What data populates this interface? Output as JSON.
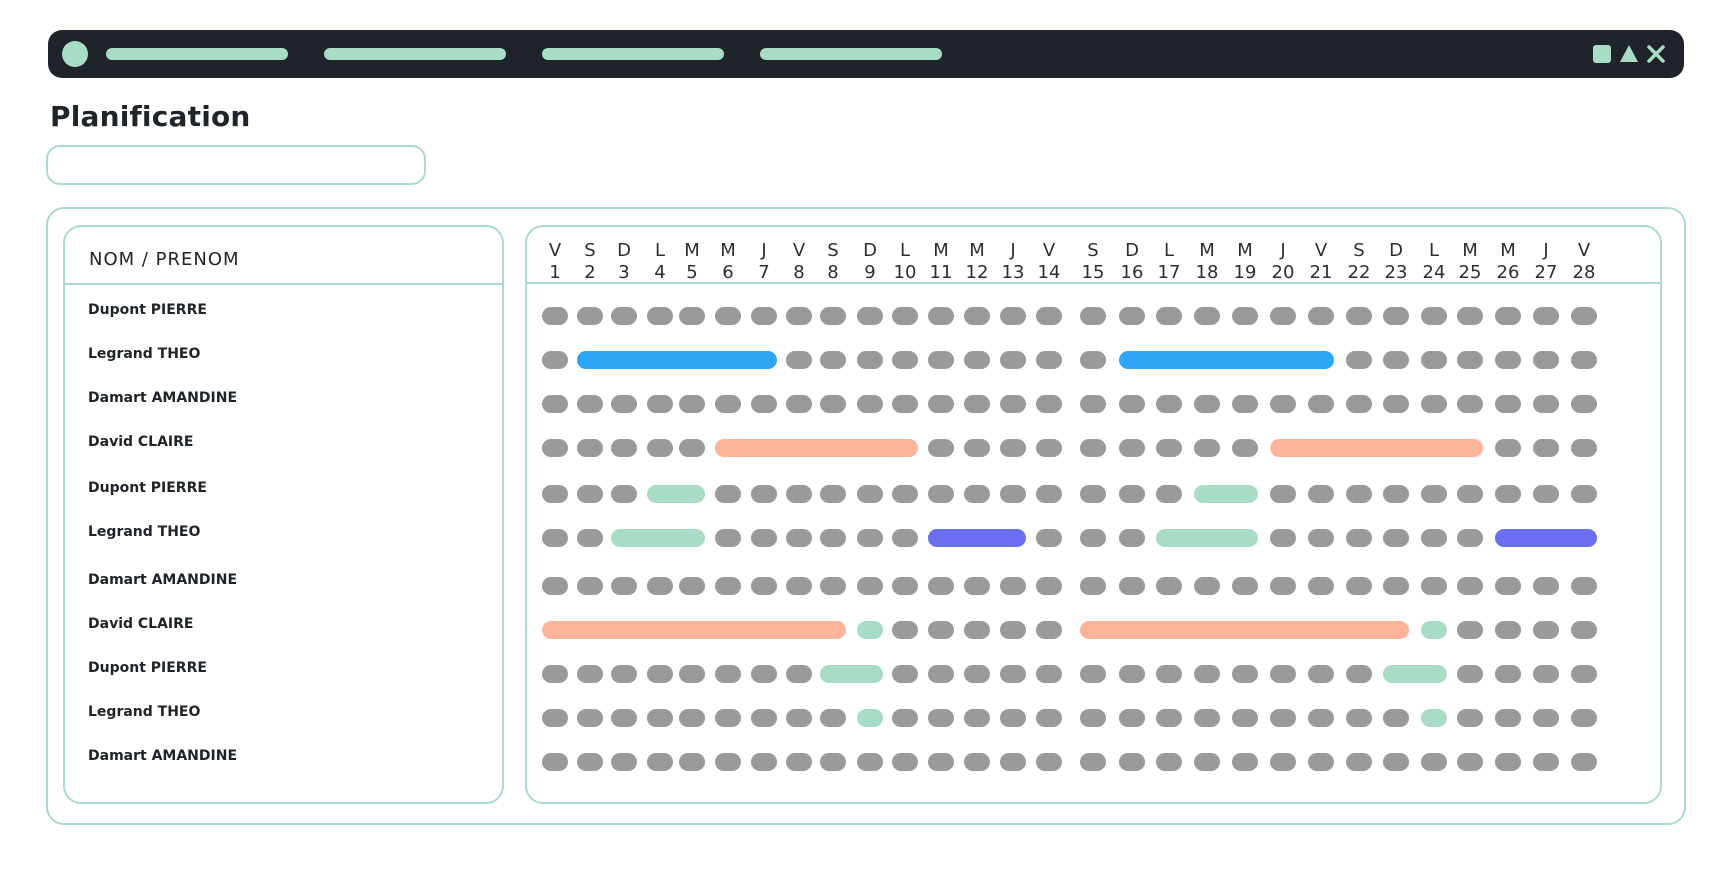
{
  "window": {
    "accent": "#a9dcc4",
    "chrome": "#1f232a",
    "nav_items": 4,
    "controls": [
      "square-icon",
      "triangle-icon",
      "close-icon"
    ]
  },
  "page": {
    "title": "Planification",
    "search": {
      "value": "",
      "placeholder": ""
    }
  },
  "table": {
    "name_header": "NOM / PRENOM",
    "days": [
      {
        "letter": "V",
        "num": "1"
      },
      {
        "letter": "S",
        "num": "2"
      },
      {
        "letter": "D",
        "num": "3"
      },
      {
        "letter": "L",
        "num": "4"
      },
      {
        "letter": "M",
        "num": "5"
      },
      {
        "letter": "M",
        "num": "6"
      },
      {
        "letter": "J",
        "num": "7"
      },
      {
        "letter": "V",
        "num": "8"
      },
      {
        "letter": "S",
        "num": "8"
      },
      {
        "letter": "D",
        "num": "9"
      },
      {
        "letter": "L",
        "num": "10"
      },
      {
        "letter": "M",
        "num": "11"
      },
      {
        "letter": "M",
        "num": "12"
      },
      {
        "letter": "J",
        "num": "13"
      },
      {
        "letter": "V",
        "num": "14"
      },
      {
        "letter": "S",
        "num": "15"
      },
      {
        "letter": "D",
        "num": "16"
      },
      {
        "letter": "L",
        "num": "17"
      },
      {
        "letter": "M",
        "num": "18"
      },
      {
        "letter": "M",
        "num": "19"
      },
      {
        "letter": "J",
        "num": "20"
      },
      {
        "letter": "V",
        "num": "21"
      },
      {
        "letter": "S",
        "num": "22"
      },
      {
        "letter": "D",
        "num": "23"
      },
      {
        "letter": "L",
        "num": "24"
      },
      {
        "letter": "M",
        "num": "25"
      },
      {
        "letter": "M",
        "num": "26"
      },
      {
        "letter": "J",
        "num": "27"
      },
      {
        "letter": "V",
        "num": "28"
      }
    ],
    "colors": {
      "empty": "#9a9a9a",
      "blue": "#2fa6f5",
      "salmon": "#fdb49b",
      "mint": "#a9dcc4",
      "indigo": "#6a6ef0"
    },
    "rows": [
      {
        "name": "Dupont PIERRE",
        "bars": []
      },
      {
        "name": "Legrand THEO",
        "bars": [
          {
            "from": 2,
            "to": 7,
            "color": "blue"
          },
          {
            "from": 17,
            "to": 22,
            "color": "blue"
          }
        ]
      },
      {
        "name": "Damart AMANDINE",
        "bars": []
      },
      {
        "name": "David CLAIRE",
        "bars": [
          {
            "from": 6,
            "to": 11,
            "color": "salmon"
          },
          {
            "from": 21,
            "to": 26,
            "color": "salmon"
          }
        ]
      },
      {
        "name": "Dupont PIERRE",
        "bars": [
          {
            "from": 4,
            "to": 5,
            "color": "mint"
          },
          {
            "from": 19,
            "to": 20,
            "color": "mint"
          }
        ]
      },
      {
        "name": "Legrand THEO",
        "bars": [
          {
            "from": 3,
            "to": 5,
            "color": "mint"
          },
          {
            "from": 12,
            "to": 14,
            "color": "indigo"
          },
          {
            "from": 18,
            "to": 20,
            "color": "mint"
          },
          {
            "from": 27,
            "to": 29,
            "color": "indigo"
          }
        ]
      },
      {
        "name": "Damart AMANDINE",
        "bars": []
      },
      {
        "name": "David CLAIRE",
        "bars": [
          {
            "from": 1,
            "to": 9,
            "color": "salmon"
          },
          {
            "from": 10,
            "to": 10,
            "color": "mint"
          },
          {
            "from": 16,
            "to": 24,
            "color": "salmon"
          },
          {
            "from": 25,
            "to": 25,
            "color": "mint"
          }
        ]
      },
      {
        "name": "Dupont PIERRE",
        "bars": [
          {
            "from": 9,
            "to": 10,
            "color": "mint"
          },
          {
            "from": 24,
            "to": 25,
            "color": "mint"
          }
        ]
      },
      {
        "name": "Legrand THEO",
        "bars": [
          {
            "from": 10,
            "to": 10,
            "color": "mint"
          },
          {
            "from": 25,
            "to": 25,
            "color": "mint"
          }
        ]
      },
      {
        "name": "Damart AMANDINE",
        "bars": []
      }
    ]
  }
}
